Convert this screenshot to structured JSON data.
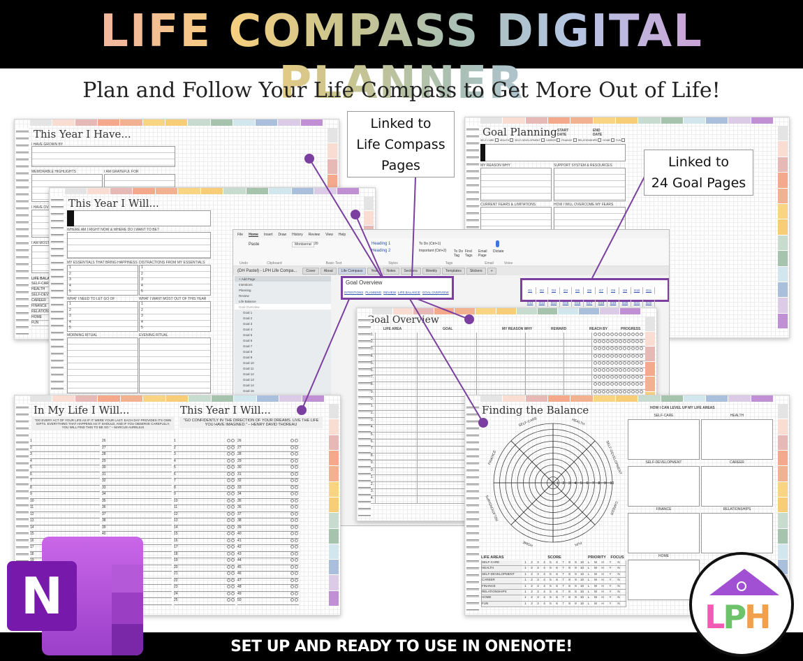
{
  "header": {
    "title": "LIFE COMPASS DIGITAL PLANNER",
    "subtitle": "Plan and Follow Your Life Compass to Get More Out of Life!"
  },
  "footer": {
    "text": "SET UP AND READY TO USE IN ONENOTE!"
  },
  "callouts": {
    "life_compass": [
      "Linked to",
      "Life Compass",
      "Pages"
    ],
    "goal_pages": [
      "Linked to",
      "24 Goal Pages"
    ]
  },
  "colors": {
    "accent": "#7b3fa0",
    "tabs": [
      "#e4e4e4",
      "#f9dcd2",
      "#e6b8b6",
      "#f4a98c",
      "#f2b190",
      "#f9d482",
      "#f7cd77",
      "#c7dccf",
      "#a6c3ad",
      "#d2e6ee",
      "#a9bfdc",
      "#dccbe6",
      "#c08fd4"
    ]
  },
  "page_have": {
    "title": "This Year I Have...",
    "grown": "I HAVE GROWN BY",
    "highlights": "MEMORABLE HIGHLIGHTS",
    "grateful": "I AM GRATEFUL FOR",
    "overcome": "I HAVE OVERCOME",
    "proud": "I AM MOST PROUD OF",
    "balance": "LIFE BALANCE"
  },
  "life_areas": [
    "SELF-CARE",
    "HEALTH",
    "SELF-DEVELOPMENT",
    "CAREER",
    "FINANCE",
    "RELATIONSHIPS",
    "HOME",
    "FUN"
  ],
  "page_will": {
    "title": "This Year I Will...",
    "where": "WHERE AM I RIGHT NOW & WHERE DO I WANT TO BE?",
    "essentials": "MY ESSENTIALS THAT BRING HAPPINESS",
    "distractions": "DISTRACTIONS FROM MY ESSENTIALS",
    "letgo": "WHAT I NEED TO LET GO OF",
    "want": "WHAT I WANT MOST OUT OF THIS YEAR",
    "morning": "MORNING RITUAL",
    "evening": "EVENING RITUAL",
    "numbers": [
      "1",
      "2",
      "3",
      "4",
      "5"
    ]
  },
  "goal_planning": {
    "title": "Goal Planning",
    "start": "START DATE",
    "end": "END DATE",
    "reason": "MY REASON WHY",
    "support": "SUPPORT SYSTEM & RESOURCES",
    "fears": "CURRENT FEARS & LIMITATIONS",
    "overcome": "HOW I WILL OVERCOME MY FEARS"
  },
  "onenote": {
    "menu": [
      "File",
      "Home",
      "Insert",
      "Draw",
      "History",
      "Review",
      "View",
      "Help"
    ],
    "ribbon": {
      "paste": "Paste",
      "font": "Montserrat",
      "size": "20",
      "heading1": "Heading 1",
      "heading2": "Heading 2",
      "todo": "To Do (Ctrl+1)",
      "important": "Important (Ctrl+2)",
      "todo_tag": "To Do Tag",
      "find_tags": "Find Tags",
      "email": "Email Page",
      "dictate": "Dictate",
      "groups": [
        "Undo",
        "Clipboard",
        "Basic Text",
        "Styles",
        "Tags",
        "Email",
        "Voice"
      ]
    },
    "notebook": "(DH Pastel) - LPH Life Compa...",
    "sections": [
      "Cover",
      "About",
      "Life Compass",
      "Year",
      "Notes",
      "Sections",
      "Weekly",
      "Templates",
      "Stickers",
      "+"
    ],
    "add_page": "+ Add Page",
    "pages": [
      "Intentions",
      "Planning",
      "Review",
      "Life Balance",
      "Goal Overview"
    ],
    "subpages": [
      "Goal 1",
      "Goal 2",
      "Goal 3",
      "Goal 4",
      "Goal 5",
      "Goal 6",
      "Goal 7",
      "Goal 8",
      "Goal 9",
      "Goal 10",
      "Goal 11",
      "Goal 12",
      "Goal 13",
      "Goal 14",
      "Goal 15"
    ],
    "page_title": "Goal Overview",
    "links": [
      "INTENTIONS",
      "PLANNING",
      "REVIEW",
      "LIFE BALANCE",
      "GOAL OVERVIEW"
    ],
    "goal_links": [
      "G1",
      "G2",
      "G3",
      "G4",
      "G5",
      "G6",
      "G7",
      "G8",
      "G9",
      "G10",
      "G11",
      "G12",
      "G13",
      "G14",
      "G15",
      "G16",
      "G17",
      "G18",
      "G19",
      "G20",
      "G21",
      "G22",
      "G23",
      "G24"
    ]
  },
  "goal_overview": {
    "title": "Goal Overview",
    "columns": [
      "LIFE AREA",
      "GOAL",
      "MY REASON WHY",
      "REWARD",
      "REACH BY",
      "PROGRESS"
    ],
    "rows": 24,
    "progress_circles": 12
  },
  "life_will": {
    "title_left": "In My Life I Will...",
    "title_right": "This Year I Will...",
    "quote_left": "\"DO EVERY ACT OF YOUR LIFE AS IF IT WERE YOUR LAST. EACH DAY PROVIDES ITS OWN GIFTS. EVERYTHING THAT HAPPENS AS IT SHOULD, AND IF YOU OBSERVE CAREFULLY, YOU WILL FIND THIS TO BE SO.\" – MARCUS AURELIUS",
    "quote_right": "\"GO CONFIDENTLY IN THE DIRECTION OF YOUR DREAMS. LIVE THE LIFE YOU HAVE IMAGINED.\" – HENRY DAVID THOREAU",
    "rows": 25
  },
  "balance": {
    "title": "Finding the Balance",
    "level_up": "HOW I CAN LEVEL UP MY LIFE AREAS",
    "wheel_labels": [
      "HEALTH",
      "SELF-DEVELOPMENT",
      "CAREER",
      "FUN",
      "HOME",
      "RELATIONSHIPS",
      "FINANCE",
      "SELF-CARE"
    ],
    "table_headers": [
      "LIFE AREAS",
      "SCORE",
      "PRIORITY",
      "FOCUS"
    ],
    "scores": [
      "1",
      "2",
      "3",
      "4",
      "5",
      "6",
      "7",
      "8",
      "9",
      "10"
    ],
    "priority": [
      "L",
      "M",
      "H"
    ],
    "focus": [
      "Y",
      "N"
    ]
  },
  "logos": {
    "onenote": "N",
    "lph": "LPH"
  }
}
